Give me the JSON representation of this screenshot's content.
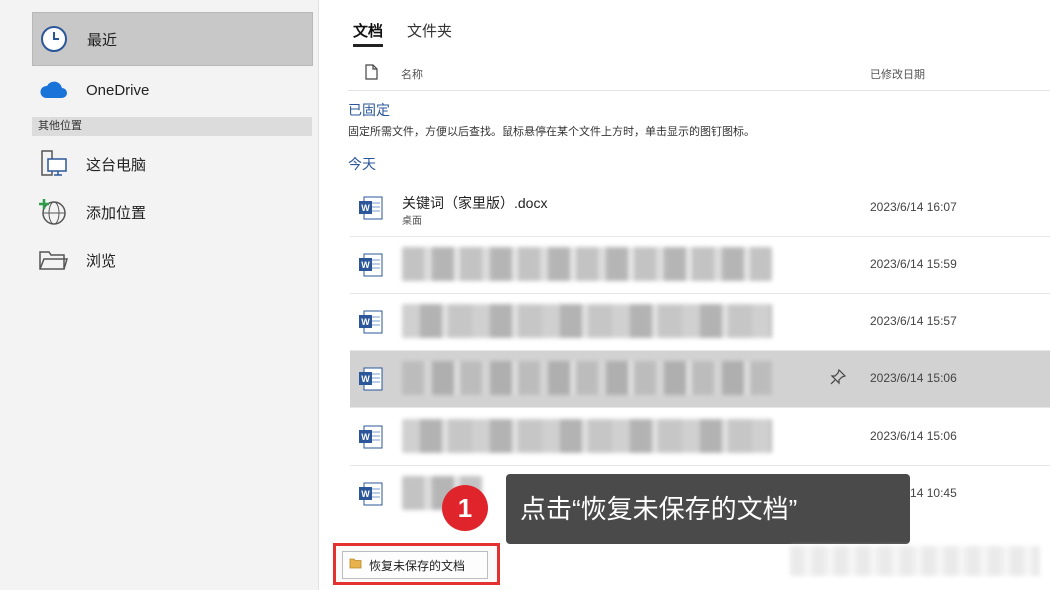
{
  "sidebar": {
    "items": [
      {
        "label": "最近",
        "icon": "clock-icon"
      },
      {
        "label": "OneDrive",
        "icon": "cloud-icon"
      },
      {
        "label": "这台电脑",
        "icon": "computer-icon"
      },
      {
        "label": "添加位置",
        "icon": "add-location-icon"
      },
      {
        "label": "浏览",
        "icon": "folder-icon"
      }
    ],
    "section_label": "其他位置"
  },
  "tabs": [
    {
      "label": "文档"
    },
    {
      "label": "文件夹"
    }
  ],
  "columns": {
    "name": "名称",
    "modified": "已修改日期"
  },
  "pinned": {
    "title": "已固定",
    "description": "固定所需文件，方便以后查找。鼠标悬停在某个文件上方时，单击显示的图钉图标。"
  },
  "today": {
    "title": "今天"
  },
  "files": [
    {
      "name": "关键词（家里版）.docx",
      "location": "桌面",
      "date": "2023/6/14 16:07"
    },
    {
      "name": "",
      "location": "",
      "date": "2023/6/14 15:59"
    },
    {
      "name": "",
      "location": "",
      "date": "2023/6/14 15:57"
    },
    {
      "name": "",
      "location": "",
      "date": "2023/6/14 15:06"
    },
    {
      "name": "",
      "location": "",
      "date": "2023/6/14 15:06"
    },
    {
      "name": "",
      "location": "",
      "date": "2023/6/14 10:45"
    }
  ],
  "callout": {
    "step": "1",
    "text": "点击“恢复未保存的文档”"
  },
  "recover_button": {
    "label": "恢复未保存的文档"
  },
  "colors": {
    "word_blue": "#2b579a",
    "badge_red": "#e0242c",
    "highlight_border": "#e53030"
  }
}
